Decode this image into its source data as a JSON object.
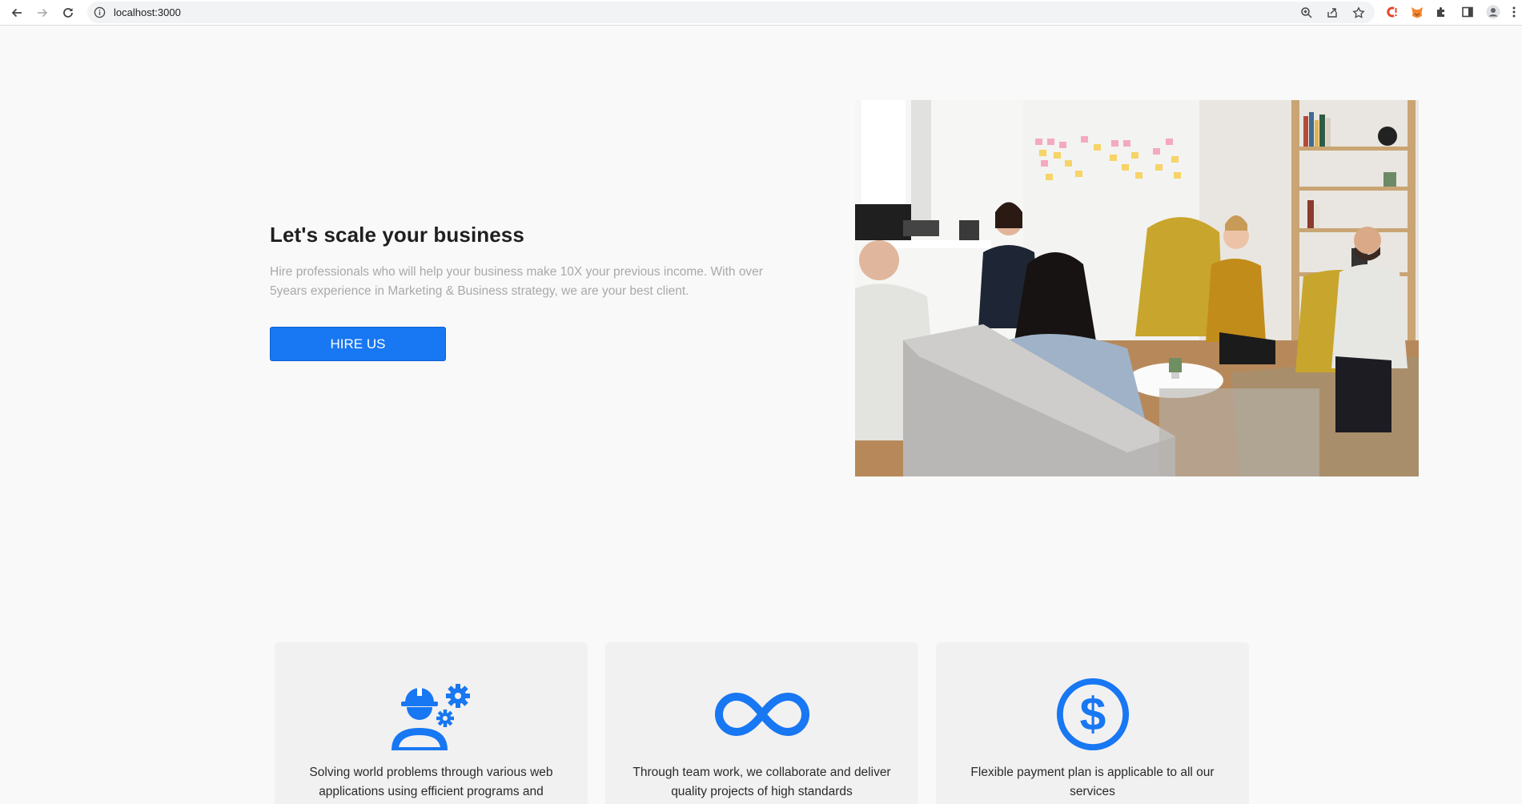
{
  "browser": {
    "url": "localhost:3000",
    "icons": {
      "back": "arrow-left-icon",
      "forward": "arrow-right-icon",
      "reload": "reload-icon",
      "site_info": "info-icon",
      "zoom": "zoom-icon",
      "share": "share-icon",
      "bookmark": "star-icon",
      "extensions": "puzzle-icon",
      "side_panel": "side-panel-icon",
      "profile": "profile-icon",
      "menu": "kebab-menu-icon"
    }
  },
  "hero": {
    "heading": "Let's scale your business",
    "description": "Hire professionals who will help your business make 10X your previous income. With over 5years experience in Marketing & Business strategy, we are your best client.",
    "cta_label": "HIRE US",
    "image_icon": "team-meeting-photo"
  },
  "features": [
    {
      "icon": "engineer-gears-icon",
      "text": "Solving world problems through various web applications using efficient programs and"
    },
    {
      "icon": "infinity-icon",
      "text": "Through team work, we collaborate and deliver quality projects of high standards"
    },
    {
      "icon": "dollar-circle-icon",
      "text": "Flexible payment plan is applicable to all our services"
    }
  ],
  "colors": {
    "accent": "#1877f2",
    "page_background": "#f9f9f9",
    "card_background": "#f2f1f1",
    "heading": "#1f1f1f",
    "muted_text": "#a9a9a9"
  }
}
